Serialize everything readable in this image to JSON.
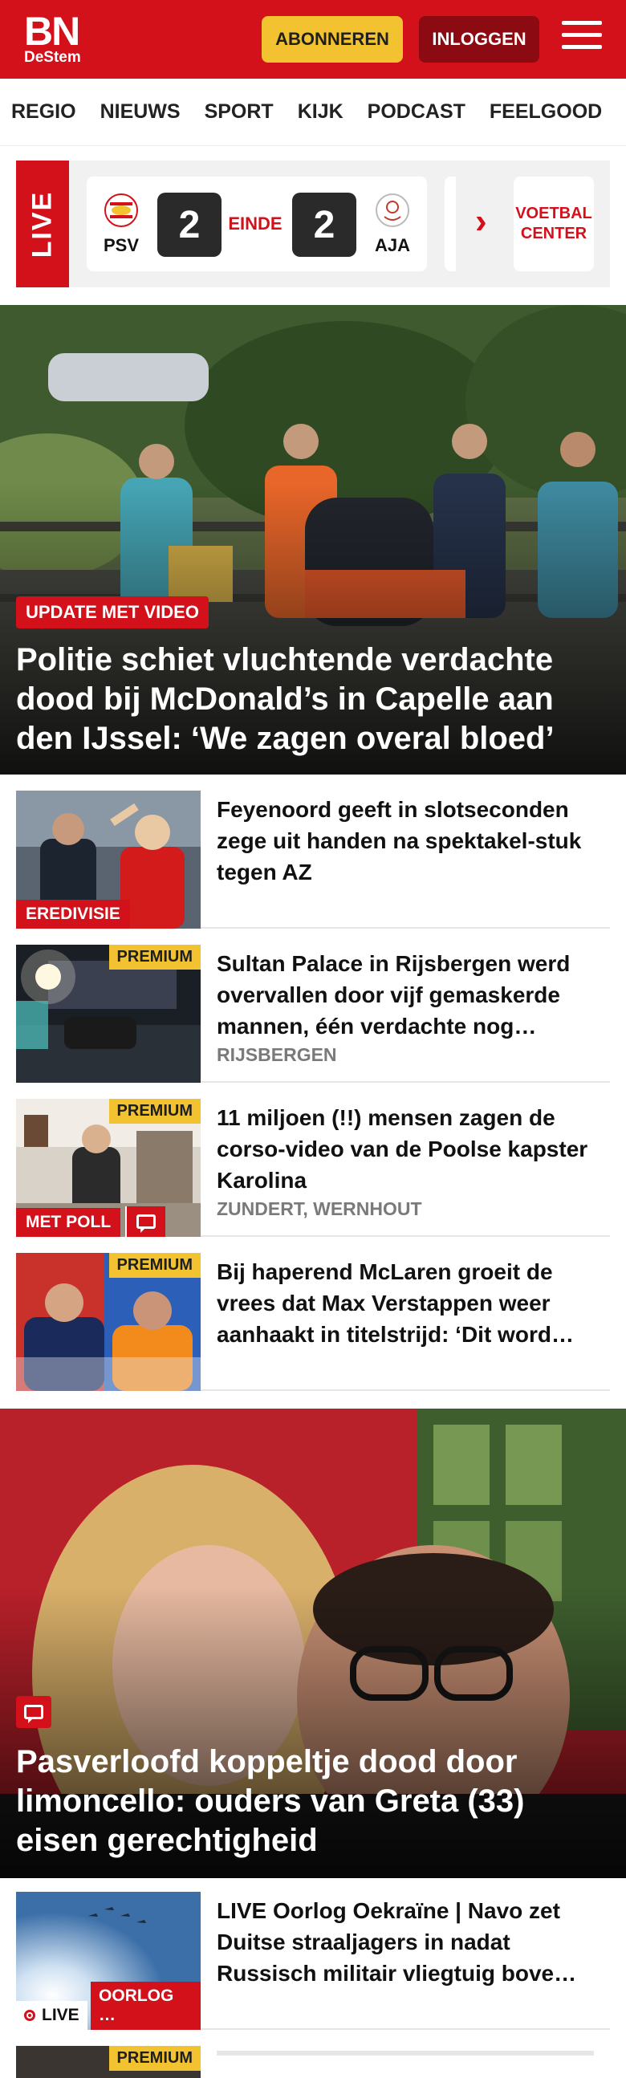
{
  "header": {
    "logo_main": "BN",
    "logo_sub": "DeStem",
    "subscribe_label": "ABONNEREN",
    "login_label": "INLOGGEN",
    "brand_color": "#d3111a"
  },
  "nav": {
    "items": [
      "REGIO",
      "NIEUWS",
      "SPORT",
      "KIJK",
      "PODCAST",
      "FEELGOOD"
    ]
  },
  "live": {
    "tag": "LIVE",
    "home_team": "PSV",
    "home_score": "2",
    "status": "EINDE",
    "away_score": "2",
    "away_team": "AJA",
    "voetbal_center": "VOETBAL CENTER"
  },
  "hero1": {
    "label": "UPDATE MET VIDEO",
    "title": "Politie schiet vluchtende verdachte dood bij McDonald’s in Capelle aan den IJssel: ‘We zagen overal bloed’"
  },
  "articles": [
    {
      "title": "Feyenoord geeft in slotseconden zege uit handen na spektakel-stuk tegen AZ",
      "label": "EREDIVISIE",
      "meta": ""
    },
    {
      "title": "Sultan Palace in Rijsbergen werd overvallen door vijf gemaskerde mannen, één verdachte nog…",
      "premium": "PREMIUM",
      "meta": "RIJSBERGEN"
    },
    {
      "title": "11 miljoen (!!) mensen zagen de corso-video van de Poolse kapster Karolina",
      "premium": "PREMIUM",
      "label": "MET POLL",
      "meta": "ZUNDERT, WERNHOUT"
    },
    {
      "title": "Bij haperend McLaren groeit de vrees dat Max Verstappen weer aanhaakt in titelstrijd: ‘Dit word…",
      "premium": "PREMIUM",
      "meta": ""
    }
  ],
  "hero2": {
    "title": "Pasverloofd koppeltje dood door limoncello: ouders van Greta (33) eisen gerechtigheid"
  },
  "live_article": {
    "title": "LIVE Oorlog Oekraïne | Navo zet Duitse straaljagers in nadat Russisch militair vliegtuig bove…",
    "live_label": "LIVE",
    "label": "OORLOG …"
  },
  "next_item": {
    "premium": "PREMIUM"
  }
}
